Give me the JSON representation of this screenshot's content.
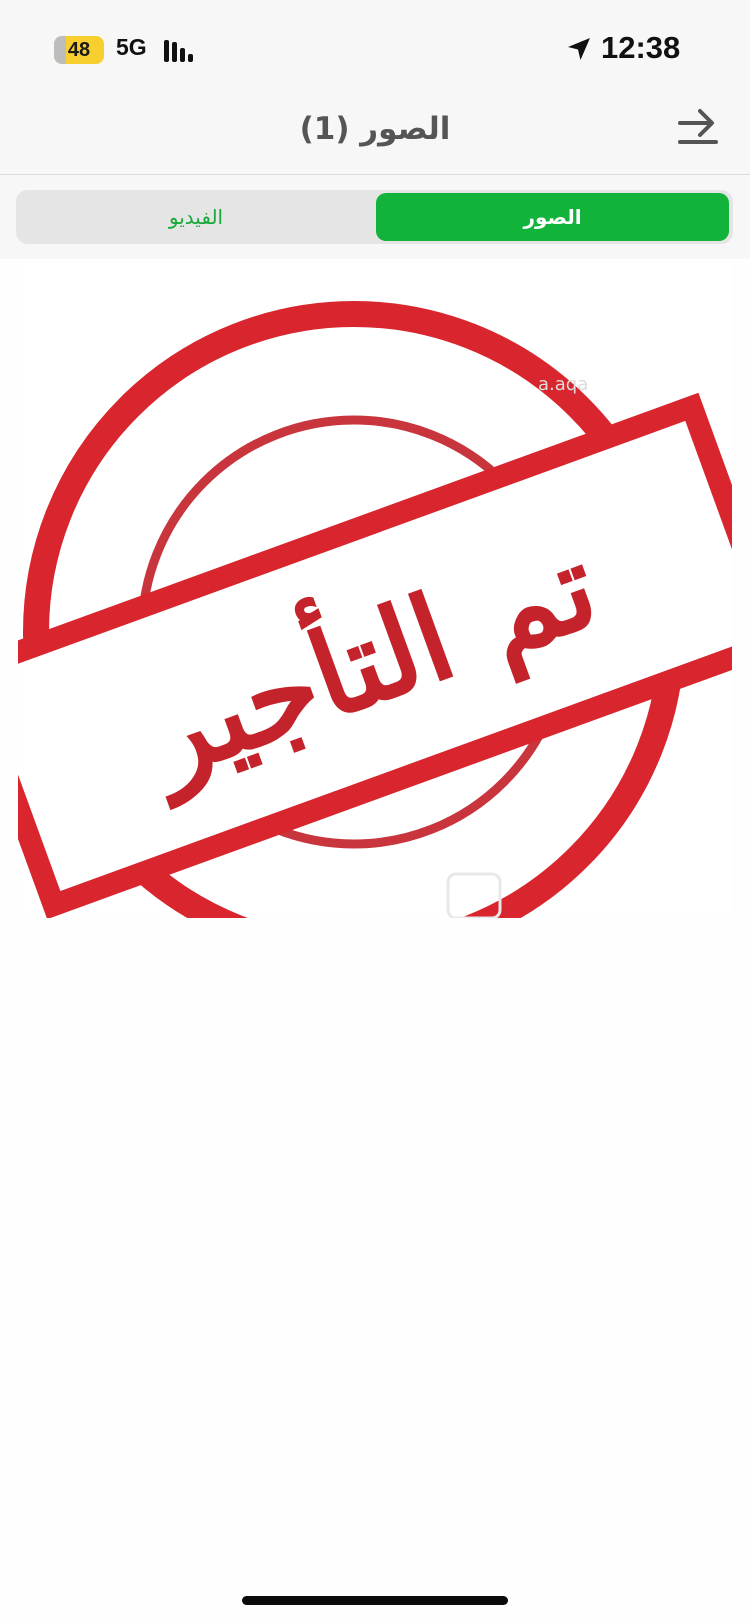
{
  "status_bar": {
    "battery_level": "48",
    "network": "5G",
    "time": "12:38",
    "battery_color": "#f7cf2f"
  },
  "header": {
    "title": "الصور (1)",
    "back_icon": "arrow-right-icon"
  },
  "tabs": [
    {
      "label": "الصور",
      "active": true
    },
    {
      "label": "الفيديو",
      "active": false
    }
  ],
  "photo": {
    "stamp_text": "تم التأجير",
    "stamp_color": "#c5232b"
  },
  "colors": {
    "accent": "#12b33b",
    "inactive_tab_text": "#19a93a"
  }
}
